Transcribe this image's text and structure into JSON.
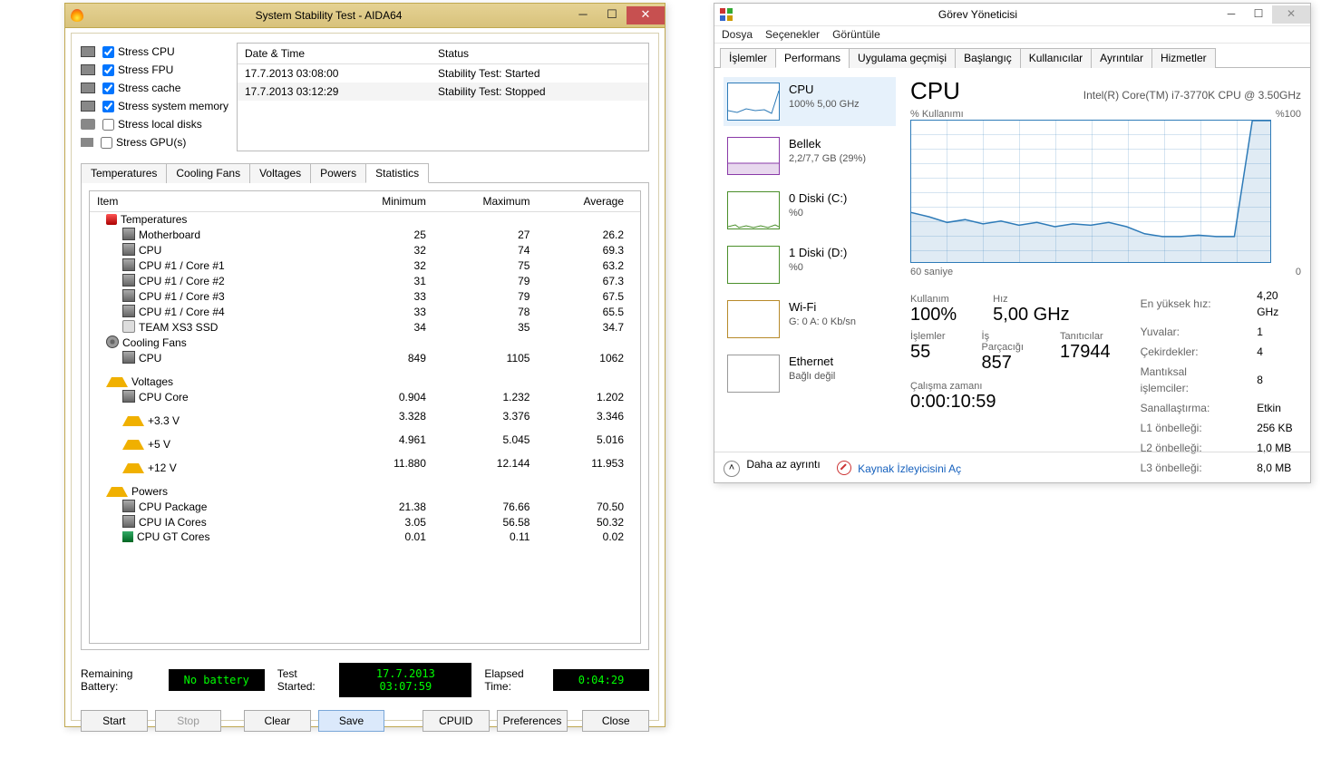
{
  "aida": {
    "title": "System Stability Test - AIDA64",
    "checks": [
      {
        "label": "Stress CPU",
        "checked": true
      },
      {
        "label": "Stress FPU",
        "checked": true
      },
      {
        "label": "Stress cache",
        "checked": true
      },
      {
        "label": "Stress system memory",
        "checked": true
      },
      {
        "label": "Stress local disks",
        "checked": false
      },
      {
        "label": "Stress GPU(s)",
        "checked": false
      }
    ],
    "log": {
      "headers": {
        "dt": "Date & Time",
        "status": "Status"
      },
      "rows": [
        {
          "dt": "17.7.2013 03:08:00",
          "status": "Stability Test: Started"
        },
        {
          "dt": "17.7.2013 03:12:29",
          "status": "Stability Test: Stopped"
        }
      ]
    },
    "tabs": [
      "Temperatures",
      "Cooling Fans",
      "Voltages",
      "Powers",
      "Statistics"
    ],
    "stat_headers": {
      "item": "Item",
      "min": "Minimum",
      "max": "Maximum",
      "avg": "Average"
    },
    "stats": [
      {
        "kind": "group",
        "icon": "therm",
        "label": "Temperatures"
      },
      {
        "kind": "row",
        "indent": 2,
        "icon": "chip",
        "label": "Motherboard",
        "min": "25",
        "max": "27",
        "avg": "26.2"
      },
      {
        "kind": "row",
        "indent": 2,
        "icon": "chip",
        "label": "CPU",
        "min": "32",
        "max": "74",
        "avg": "69.3"
      },
      {
        "kind": "row",
        "indent": 2,
        "icon": "chip",
        "label": "CPU #1 / Core #1",
        "min": "32",
        "max": "75",
        "avg": "63.2"
      },
      {
        "kind": "row",
        "indent": 2,
        "icon": "chip",
        "label": "CPU #1 / Core #2",
        "min": "31",
        "max": "79",
        "avg": "67.3"
      },
      {
        "kind": "row",
        "indent": 2,
        "icon": "chip",
        "label": "CPU #1 / Core #3",
        "min": "33",
        "max": "79",
        "avg": "67.5"
      },
      {
        "kind": "row",
        "indent": 2,
        "icon": "chip",
        "label": "CPU #1 / Core #4",
        "min": "33",
        "max": "78",
        "avg": "65.5"
      },
      {
        "kind": "row",
        "indent": 2,
        "icon": "disk",
        "label": "TEAM XS3 SSD",
        "min": "34",
        "max": "35",
        "avg": "34.7"
      },
      {
        "kind": "group",
        "icon": "fan",
        "label": "Cooling Fans"
      },
      {
        "kind": "row",
        "indent": 2,
        "icon": "chip",
        "label": "CPU",
        "min": "849",
        "max": "1105",
        "avg": "1062"
      },
      {
        "kind": "group",
        "icon": "warn",
        "label": "Voltages"
      },
      {
        "kind": "row",
        "indent": 2,
        "icon": "chip",
        "label": "CPU Core",
        "min": "0.904",
        "max": "1.232",
        "avg": "1.202"
      },
      {
        "kind": "row",
        "indent": 2,
        "icon": "warn",
        "label": "+3.3 V",
        "min": "3.328",
        "max": "3.376",
        "avg": "3.346"
      },
      {
        "kind": "row",
        "indent": 2,
        "icon": "warn",
        "label": "+5 V",
        "min": "4.961",
        "max": "5.045",
        "avg": "5.016"
      },
      {
        "kind": "row",
        "indent": 2,
        "icon": "warn",
        "label": "+12 V",
        "min": "11.880",
        "max": "12.144",
        "avg": "11.953"
      },
      {
        "kind": "group",
        "icon": "warn",
        "label": "Powers"
      },
      {
        "kind": "row",
        "indent": 2,
        "icon": "chip",
        "label": "CPU Package",
        "min": "21.38",
        "max": "76.66",
        "avg": "70.50"
      },
      {
        "kind": "row",
        "indent": 2,
        "icon": "chip",
        "label": "CPU IA Cores",
        "min": "3.05",
        "max": "56.58",
        "avg": "50.32"
      },
      {
        "kind": "row",
        "indent": 2,
        "icon": "gpu",
        "label": "CPU GT Cores",
        "min": "0.01",
        "max": "0.11",
        "avg": "0.02"
      }
    ],
    "status": {
      "battery_label": "Remaining Battery:",
      "battery_value": "No battery",
      "started_label": "Test Started:",
      "started_value": "17.7.2013 03:07:59",
      "elapsed_label": "Elapsed Time:",
      "elapsed_value": "0:04:29"
    },
    "buttons": {
      "start": "Start",
      "stop": "Stop",
      "clear": "Clear",
      "save": "Save",
      "cpuid": "CPUID",
      "prefs": "Preferences",
      "close": "Close"
    }
  },
  "tm": {
    "title": "Görev Yöneticisi",
    "menu": [
      "Dosya",
      "Seçenekler",
      "Görüntüle"
    ],
    "tabs": [
      "İşlemler",
      "Performans",
      "Uygulama geçmişi",
      "Başlangıç",
      "Kullanıcılar",
      "Ayrıntılar",
      "Hizmetler"
    ],
    "side": [
      {
        "title": "CPU",
        "sub": "100%  5,00 GHz",
        "color": "#2e7bb8",
        "selected": true
      },
      {
        "title": "Bellek",
        "sub": "2,2/7,7 GB (29%)",
        "color": "#8a3aa8"
      },
      {
        "title": "0 Diski (C:)",
        "sub": "%0",
        "color": "#4a8f2a"
      },
      {
        "title": "1 Diski (D:)",
        "sub": "%0",
        "color": "#4a8f2a"
      },
      {
        "title": "Wi-Fi",
        "sub": "G: 0  A: 0 Kb/sn",
        "color": "#b78a2a"
      },
      {
        "title": "Ethernet",
        "sub": "Bağlı değil",
        "color": "#999"
      }
    ],
    "main": {
      "title": "CPU",
      "model": "Intel(R) Core(TM) i7-3770K CPU @ 3.50GHz",
      "chart_top_left": "% Kullanımı",
      "chart_top_right": "%100",
      "chart_bottom_left": "60 saniye",
      "chart_bottom_right": "0",
      "stats1": [
        {
          "lbl": "Kullanım",
          "val": "100%"
        },
        {
          "lbl": "Hız",
          "val": "5,00 GHz"
        }
      ],
      "stats2": [
        {
          "lbl": "İşlemler",
          "val": "55"
        },
        {
          "lbl": "İş Parçacığı",
          "val": "857"
        },
        {
          "lbl": "Tanıtıcılar",
          "val": "17944"
        }
      ],
      "uptime_label": "Çalışma zamanı",
      "uptime_value": "0:00:10:59",
      "kv": [
        {
          "k": "En yüksek hız:",
          "v": "4,20 GHz"
        },
        {
          "k": "Yuvalar:",
          "v": "1"
        },
        {
          "k": "Çekirdekler:",
          "v": "4"
        },
        {
          "k": "Mantıksal işlemciler:",
          "v": "8"
        },
        {
          "k": "Sanallaştırma:",
          "v": "Etkin"
        },
        {
          "k": "L1 önbelleği:",
          "v": "256 KB"
        },
        {
          "k": "L2 önbelleği:",
          "v": "1,0 MB"
        },
        {
          "k": "L3 önbelleği:",
          "v": "8,0 MB"
        }
      ]
    },
    "footer": {
      "fewer": "Daha az ayrıntı",
      "resmon": "Kaynak İzleyicisini Aç"
    }
  },
  "chart_data": {
    "type": "line",
    "title": "CPU % Kullanımı",
    "xlabel": "60 saniye",
    "ylabel": "% Kullanımı",
    "ylim": [
      0,
      100
    ],
    "x_seconds_ago": [
      60,
      57,
      54,
      51,
      48,
      45,
      42,
      39,
      36,
      33,
      30,
      27,
      24,
      21,
      18,
      15,
      12,
      9,
      6,
      3,
      0
    ],
    "values": [
      35,
      32,
      28,
      30,
      27,
      29,
      26,
      28,
      25,
      27,
      26,
      28,
      25,
      20,
      18,
      18,
      19,
      18,
      18,
      100,
      100
    ]
  }
}
